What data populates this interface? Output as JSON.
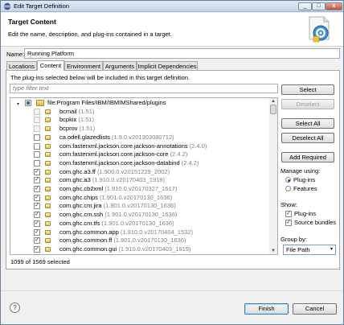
{
  "window": {
    "title": "Edit Target Definition",
    "min_glyph": "_",
    "max_glyph": "□",
    "close_glyph": "x"
  },
  "header": {
    "title": "Target Content",
    "description": "Edit the name, description, and plug-ins contained in a target.",
    "icon": "target-definition-icon"
  },
  "name_field": {
    "label": "Name:",
    "value": "Running Platform"
  },
  "tabs": [
    {
      "label": "Locations",
      "active": false
    },
    {
      "label": "Content",
      "active": true
    },
    {
      "label": "Environment",
      "active": false
    },
    {
      "label": "Arguments",
      "active": false
    },
    {
      "label": "Implicit Dependencies",
      "active": false
    }
  ],
  "content": {
    "description": "The plug-ins selected below will be included in this target definition.",
    "filter_placeholder": "type filter text",
    "tree": {
      "root_label": "file:Program Files/IBM/IBMIMShared/plugins",
      "root_expander": "▾",
      "items": [
        {
          "name": "bcmail",
          "version": "(1.51)",
          "checked": false,
          "disabled": true
        },
        {
          "name": "bcpkix",
          "version": "(1.51)",
          "checked": false,
          "disabled": true
        },
        {
          "name": "bcprov",
          "version": "(1.51)",
          "checked": false,
          "disabled": true
        },
        {
          "name": "ca.odell.glazedlists",
          "version": "(1.9.0.v201303080712)",
          "checked": false,
          "disabled": false
        },
        {
          "name": "com.fasterxml.jackson.core.jackson-annotations",
          "version": "(2.4.0)",
          "checked": false,
          "disabled": false
        },
        {
          "name": "com.fasterxml.jackson.core.jackson-core",
          "version": "(2.4.2)",
          "checked": false,
          "disabled": false
        },
        {
          "name": "com.fasterxml.jackson.core.jackson-databind",
          "version": "(2.4.2)",
          "checked": false,
          "disabled": false
        },
        {
          "name": "com.ghc.a3.ff",
          "version": "(1.900.0.v20151229_2002)",
          "checked": true,
          "disabled": false
        },
        {
          "name": "com.ghc.a3",
          "version": "(1.910.0.v20170403_1919)",
          "checked": true,
          "disabled": false
        },
        {
          "name": "com.ghc.cb2xml",
          "version": "(1.910.0.v20170327_1617)",
          "checked": true,
          "disabled": false
        },
        {
          "name": "com.ghc.chips",
          "version": "(1.901.0.v20170130_1636)",
          "checked": true,
          "disabled": false
        },
        {
          "name": "com.ghc.cm.jira",
          "version": "(1.901.0.v20170130_1636)",
          "checked": true,
          "disabled": false
        },
        {
          "name": "com.ghc.cm.ssh",
          "version": "(1.901.0.v20170130_1636)",
          "checked": true,
          "disabled": false
        },
        {
          "name": "com.ghc.cm.tfs",
          "version": "(1.901.0.v20170130_1636)",
          "checked": true,
          "disabled": false
        },
        {
          "name": "com.ghc.common.app",
          "version": "(1.910.0.v20170404_1532)",
          "checked": true,
          "disabled": false
        },
        {
          "name": "com.ghc.common.ff",
          "version": "(1.901.0.v20170130_1636)",
          "checked": true,
          "disabled": false
        },
        {
          "name": "com.ghc.common.gui",
          "version": "(1.910.0.v20170403_1919)",
          "checked": true,
          "disabled": false
        }
      ]
    },
    "selected_count": "1099 of 1569 selected"
  },
  "buttons": {
    "select": "Select",
    "deselect": "Deselect",
    "select_all": "Select All",
    "deselect_all": "Deselect All",
    "add_required": "Add Required"
  },
  "managing": {
    "label": "Manage using:",
    "options": [
      {
        "label": "Plug-ins",
        "selected": true
      },
      {
        "label": "Features",
        "selected": false
      }
    ]
  },
  "show": {
    "label": "Show:",
    "options": [
      {
        "label": "Plug-ins",
        "checked": true
      },
      {
        "label": "Source bundles",
        "checked": true
      }
    ]
  },
  "group_by": {
    "label": "Group by:",
    "value": "File Path",
    "arrow": "▾"
  },
  "footer": {
    "help_glyph": "?",
    "finish": "Finish",
    "cancel": "Cancel"
  },
  "colors": {
    "accent": "#3c7fb1",
    "version_text": "#808080",
    "check": "#224"
  }
}
